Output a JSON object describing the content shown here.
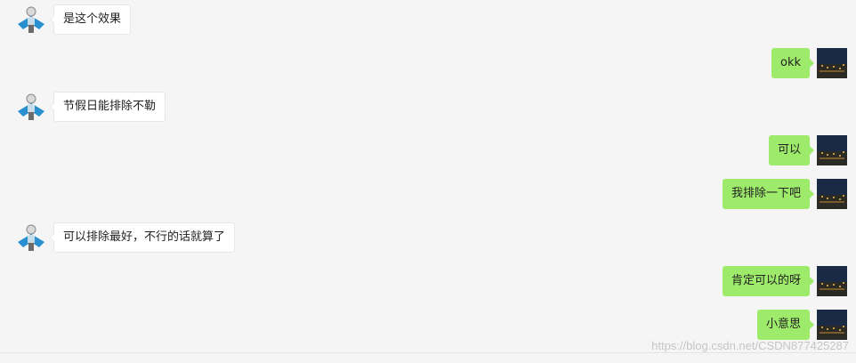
{
  "colors": {
    "background": "#f5f5f5",
    "sent_bubble": "#9eea6a",
    "received_bubble": "#ffffff"
  },
  "messages": [
    {
      "side": "left",
      "text": "是这个效果"
    },
    {
      "side": "right",
      "text": "okk"
    },
    {
      "side": "left",
      "text": "节假日能排除不勒"
    },
    {
      "side": "right",
      "text": "可以"
    },
    {
      "side": "right",
      "text": "我排除一下吧"
    },
    {
      "side": "left",
      "text": "可以排除最好，不行的话就算了"
    },
    {
      "side": "right",
      "text": "肯定可以的呀"
    },
    {
      "side": "right",
      "text": "小意思"
    }
  ],
  "watermark": "https://blog.csdn.net/CSDN877425287",
  "icons": {
    "left_avatar": "person-with-blue-cape-avatar",
    "right_avatar": "night-city-avatar"
  }
}
